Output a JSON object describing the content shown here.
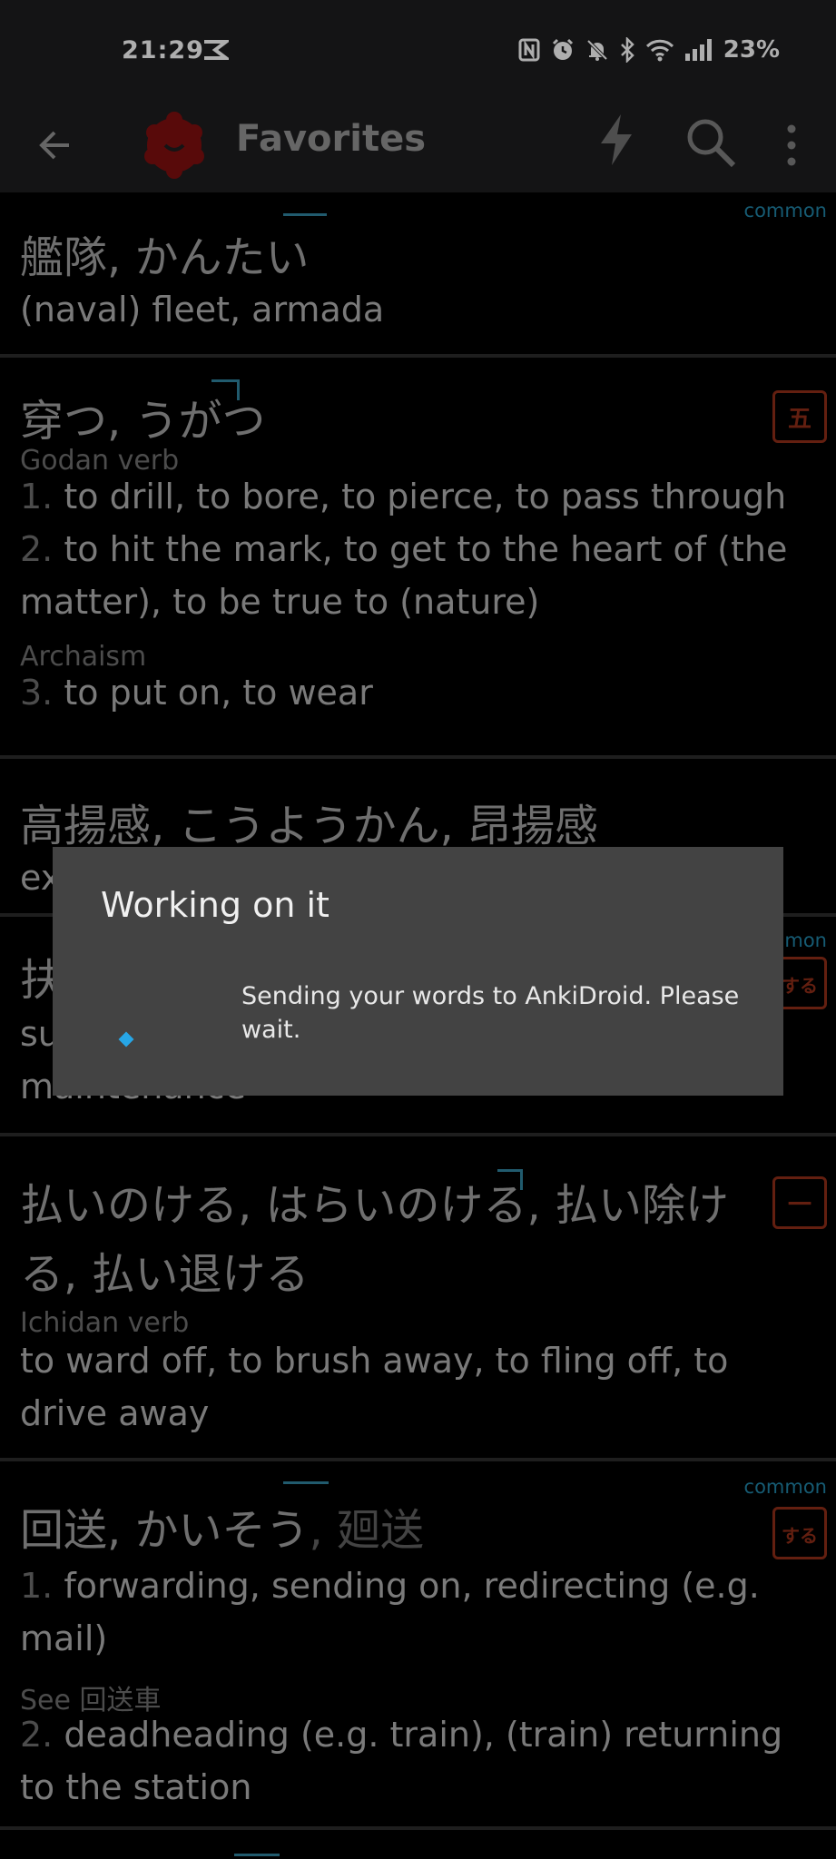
{
  "status": {
    "time": "21:29",
    "battery": "23%"
  },
  "appbar": {
    "title": "Favorites"
  },
  "entries": [
    {
      "jp": "艦隊, かんたい",
      "common": "common",
      "definition": "(naval) fleet, armada"
    },
    {
      "jp": "穿つ, うがつ",
      "stamp": "五",
      "pos": "Godan verb",
      "d1_num": "1.",
      "d1": " to drill, to bore, to pierce, to pass through",
      "d2_num": "2.",
      "d2": " to hit the mark, to get to the heart of (the matter), to be true to (nature)",
      "note": "Archaism",
      "d3_num": "3.",
      "d3": " to put on, to wear"
    },
    {
      "jp": "高揚感, こうようかん, 昂揚感",
      "definition_fragment": "ex"
    },
    {
      "jp_fragment": "扶",
      "common": "common",
      "stamp": "する",
      "line1": "su",
      "line2": "maintenance"
    },
    {
      "jp": "払いのける, はらいのける, 払い除ける, 払い退ける",
      "stamp": "一",
      "pos": "Ichidan verb",
      "definition": "to ward off, to brush away, to fling off, to drive away"
    },
    {
      "jp_main": "回送, かいそう",
      "jp_alt": ", 廻送",
      "common": "common",
      "stamp": "する",
      "d1_num": "1.",
      "d1": " forwarding, sending on, redirecting (e.g. mail)",
      "see": "See 回送車",
      "d2_num": "2.",
      "d2": " deadheading (e.g. train), (train) returning to the station"
    }
  ],
  "dialog": {
    "title": "Working on it",
    "message": "Sending your words to AnkiDroid. Please wait."
  }
}
